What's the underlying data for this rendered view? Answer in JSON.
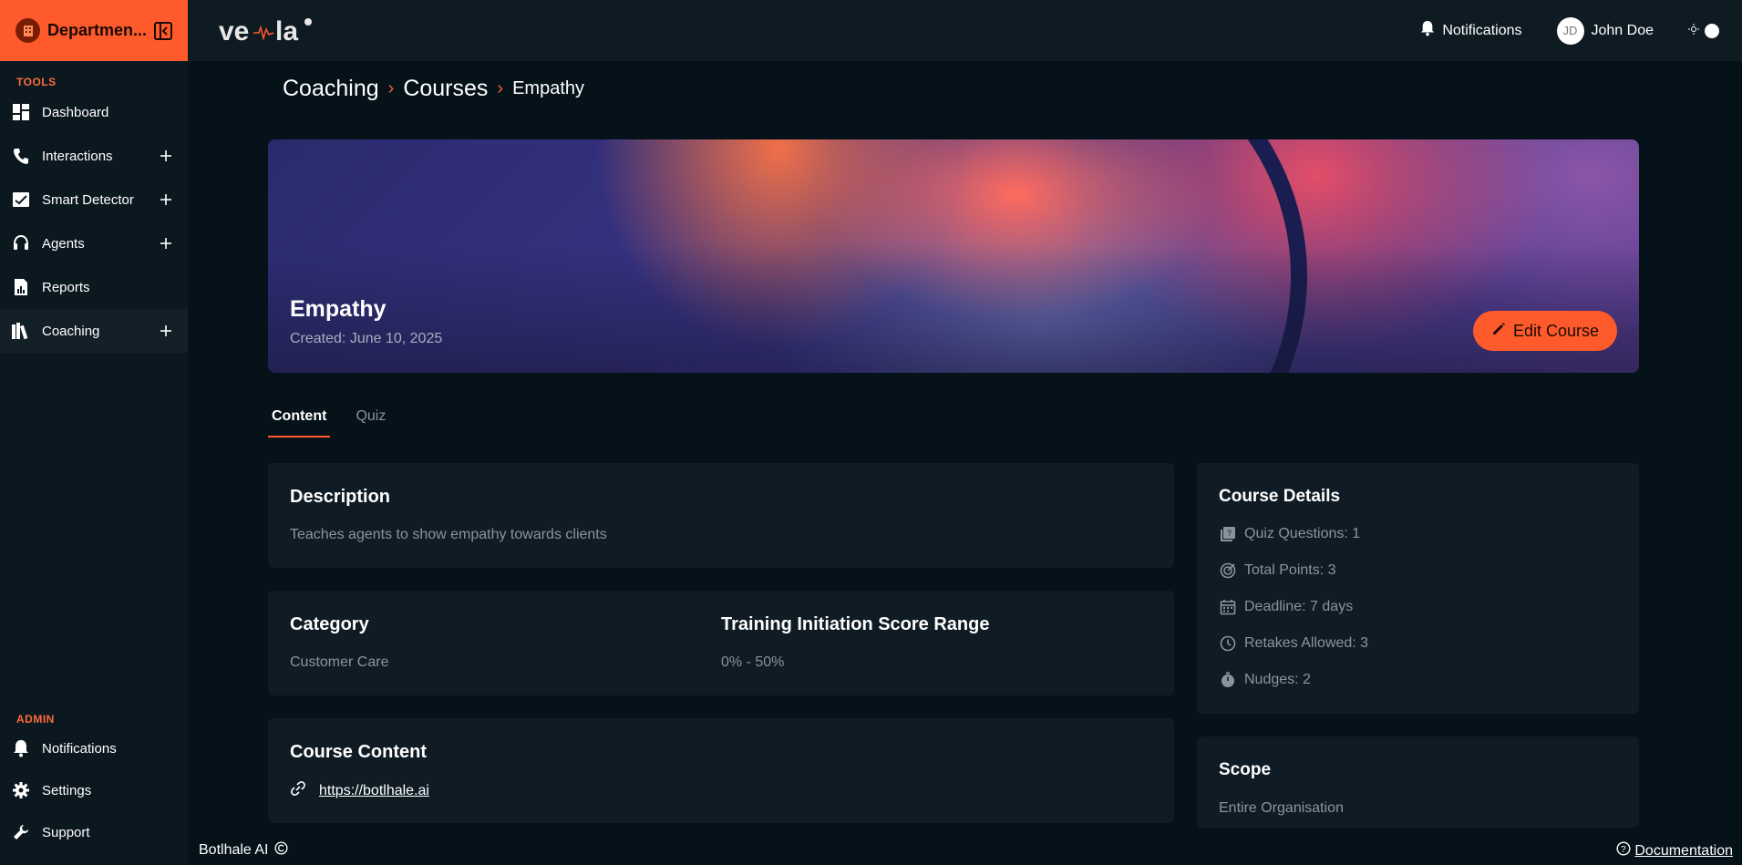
{
  "sidebar": {
    "department": "Departmen...",
    "tools_label": "TOOLS",
    "admin_label": "ADMIN",
    "items": [
      {
        "label": "Dashboard"
      },
      {
        "label": "Interactions"
      },
      {
        "label": "Smart Detector"
      },
      {
        "label": "Agents"
      },
      {
        "label": "Reports"
      },
      {
        "label": "Coaching"
      }
    ],
    "admin_items": [
      {
        "label": "Notifications"
      },
      {
        "label": "Settings"
      },
      {
        "label": "Support"
      }
    ]
  },
  "topbar": {
    "brand": "ve·la",
    "notifications_label": "Notifications",
    "user_initials": "JD",
    "user_name": "John Doe"
  },
  "breadcrumb": [
    "Coaching",
    "Courses",
    "Empathy"
  ],
  "course": {
    "title": "Empathy",
    "created": "Created: June 10, 2025",
    "edit_label": "Edit Course"
  },
  "tabs": [
    "Content",
    "Quiz"
  ],
  "description": {
    "title": "Description",
    "text": "Teaches agents to show empathy towards clients"
  },
  "category": {
    "title": "Category",
    "value": "Customer Care",
    "range_title": "Training Initiation Score Range",
    "range_value": "0% - 50%"
  },
  "content": {
    "title": "Course Content",
    "link": "https://botlhale.ai"
  },
  "details": {
    "title": "Course Details",
    "rows": [
      "Quiz Questions: 1",
      "Total Points: 3",
      "Deadline: 7 days",
      "Retakes Allowed: 3",
      "Nudges: 2"
    ]
  },
  "scope": {
    "title": "Scope",
    "value": "Entire Organisation"
  },
  "footer": {
    "left": "Botlhale AI",
    "right": "Documentation"
  },
  "colors": {
    "accent": "#ff5a2b",
    "background": "#05121a",
    "card": "#0f1c25"
  }
}
